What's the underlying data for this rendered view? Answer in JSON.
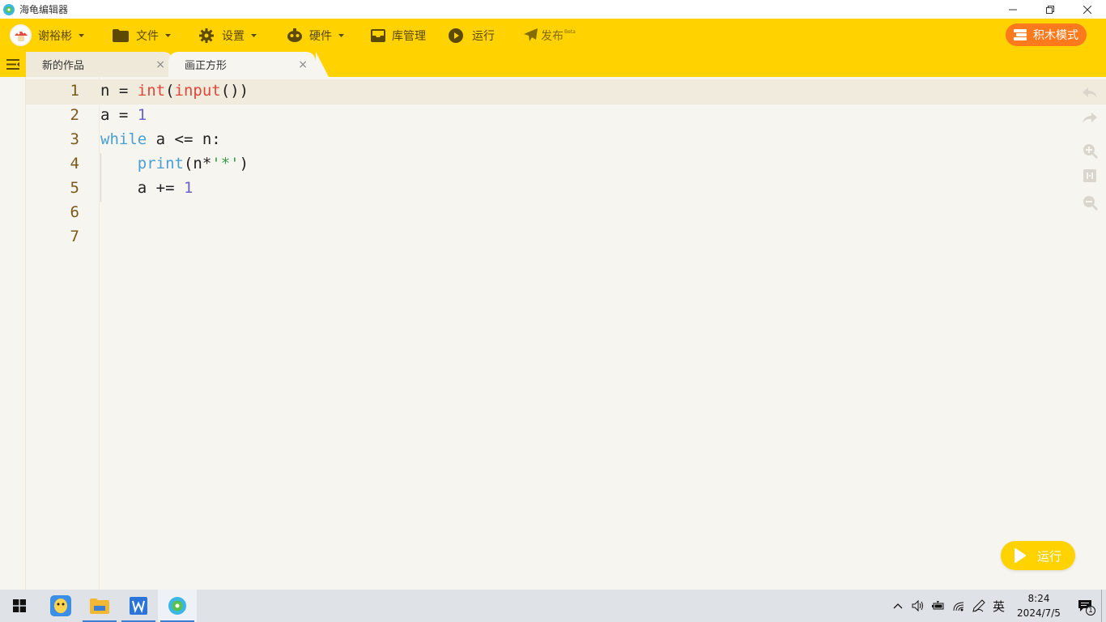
{
  "window": {
    "title": "海龟编辑器"
  },
  "menubar": {
    "user": "谢裕彬",
    "file": "文件",
    "settings": "设置",
    "hardware": "硬件",
    "library": "库管理",
    "run": "运行",
    "publish": "发布",
    "publish_badge": "Beta",
    "blocks_mode": "积木模式"
  },
  "tabs": [
    {
      "label": "新的作品",
      "close": "×"
    },
    {
      "label": "画正方形",
      "close": "×"
    }
  ],
  "editor": {
    "line_numbers": [
      "1",
      "2",
      "3",
      "4",
      "5",
      "6",
      "7"
    ],
    "lines": [
      {
        "tokens": [
          {
            "t": "n = ",
            "c": ""
          },
          {
            "t": "int",
            "c": "fn"
          },
          {
            "t": "(",
            "c": ""
          },
          {
            "t": "input",
            "c": "fn"
          },
          {
            "t": "())",
            "c": ""
          }
        ]
      },
      {
        "tokens": [
          {
            "t": "a = ",
            "c": ""
          },
          {
            "t": "1",
            "c": "num"
          }
        ]
      },
      {
        "tokens": [
          {
            "t": "while",
            "c": "kw"
          },
          {
            "t": " a <= n:",
            "c": ""
          }
        ]
      },
      {
        "tokens": [
          {
            "t": "    ",
            "c": ""
          },
          {
            "t": "print",
            "c": "kw"
          },
          {
            "t": "(n*",
            "c": ""
          },
          {
            "t": "'*'",
            "c": "str"
          },
          {
            "t": ")",
            "c": ""
          }
        ]
      },
      {
        "tokens": [
          {
            "t": "    a += ",
            "c": ""
          },
          {
            "t": "1",
            "c": "num"
          }
        ]
      }
    ]
  },
  "run_button": {
    "label": "运行"
  },
  "taskbar": {
    "time": "8:24",
    "date": "2024/7/5",
    "ime": "英",
    "notification_count": "1"
  },
  "colors": {
    "toolbar": "#ffd200",
    "accent_orange": "#ff7a1c",
    "editor_bg": "#f7f5f0"
  }
}
